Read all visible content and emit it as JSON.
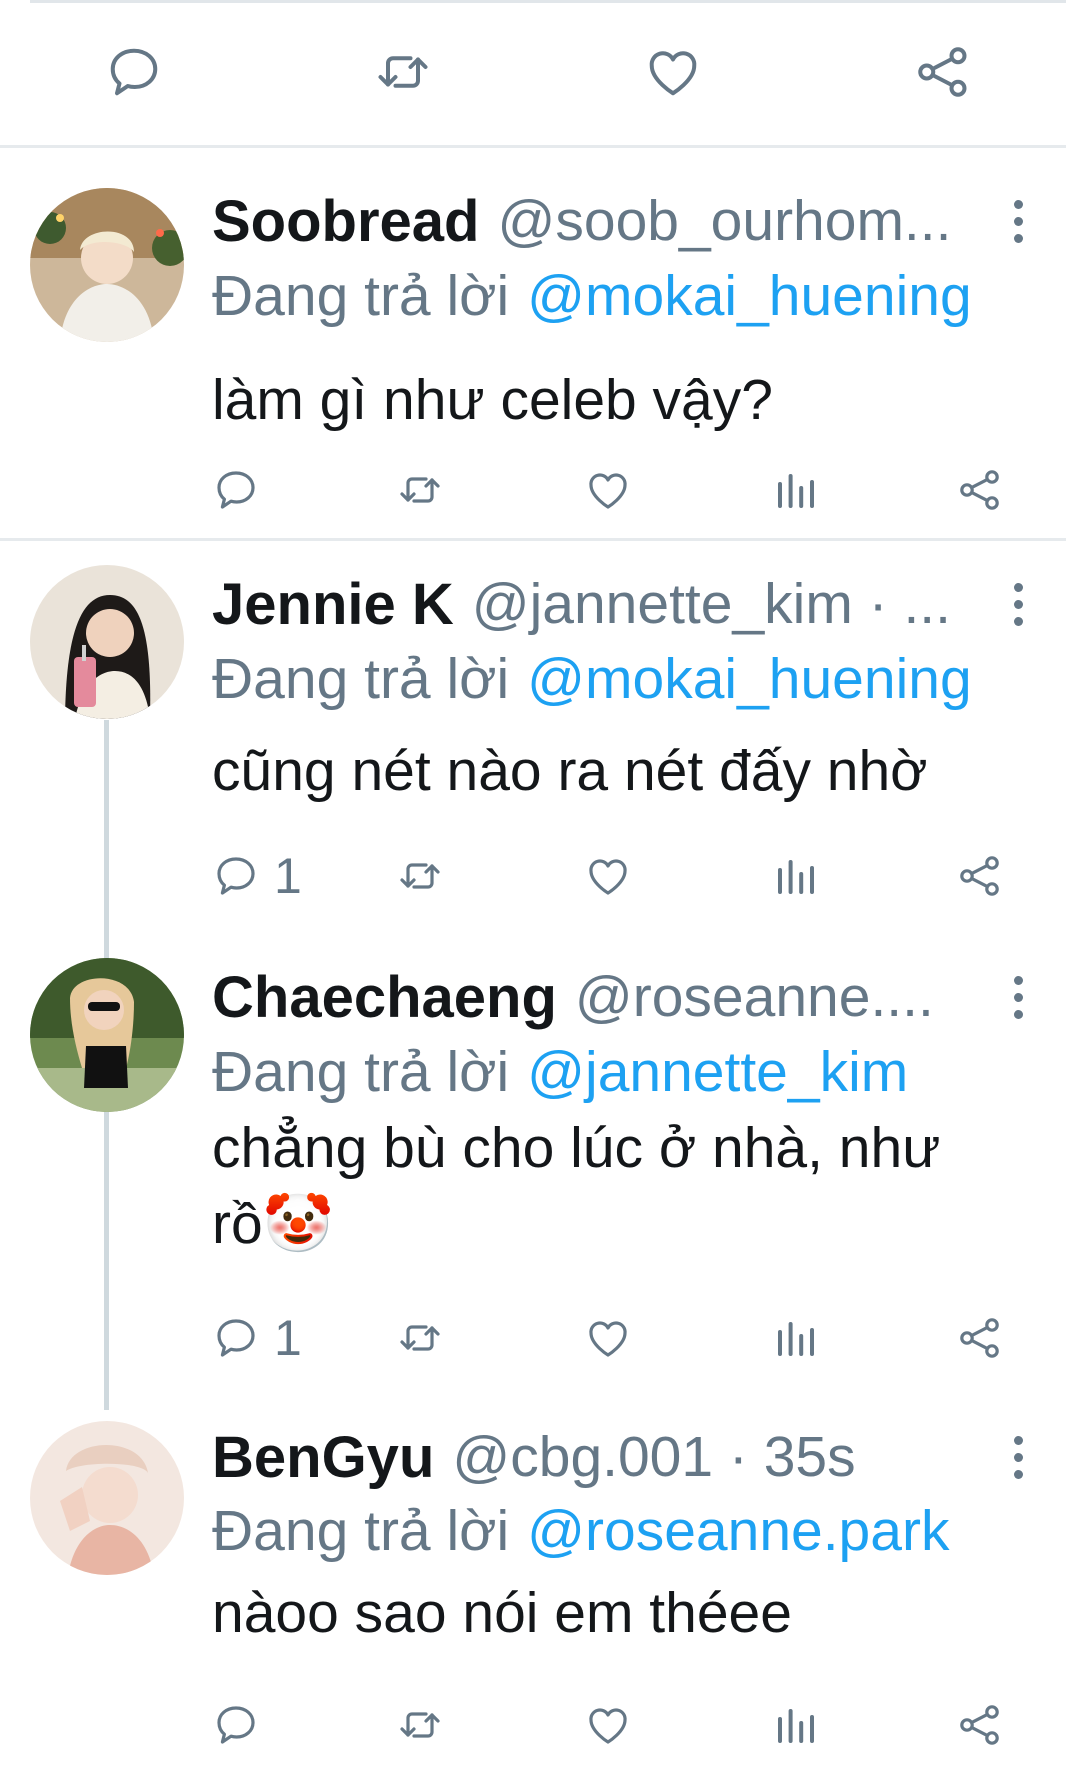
{
  "colors": {
    "name": "#14171a",
    "secondary": "#657786",
    "mention": "#1da1f2",
    "divider": "#e6eaed"
  },
  "top_actions": [
    "reply-icon",
    "retweet-icon",
    "like-icon",
    "share-icon"
  ],
  "reply_prefix": "Đang trả lời",
  "tweets": [
    {
      "name": "Soobread",
      "handle": "@soob_ourhom...",
      "reply_to": "@mokai_huening",
      "text": "làm gì như celeb vậy?",
      "reply_count": ""
    },
    {
      "name": "Jennie K",
      "handle": "@jannette_kim · ...",
      "reply_to": "@mokai_huening",
      "text": "cũng nét nào ra nét đấy nhờ",
      "reply_count": "1"
    },
    {
      "name": "Chaechaeng",
      "handle": "@roseanne....",
      "reply_to": "@jannette_kim",
      "text": "chẳng bù cho lúc ở nhà, như rồ🤡",
      "reply_count": "1"
    },
    {
      "name": "BenGyu",
      "handle": "@cbg.001 · 35s",
      "reply_to": "@roseanne.park",
      "text": "nàoo sao nói em théee",
      "reply_count": ""
    }
  ]
}
